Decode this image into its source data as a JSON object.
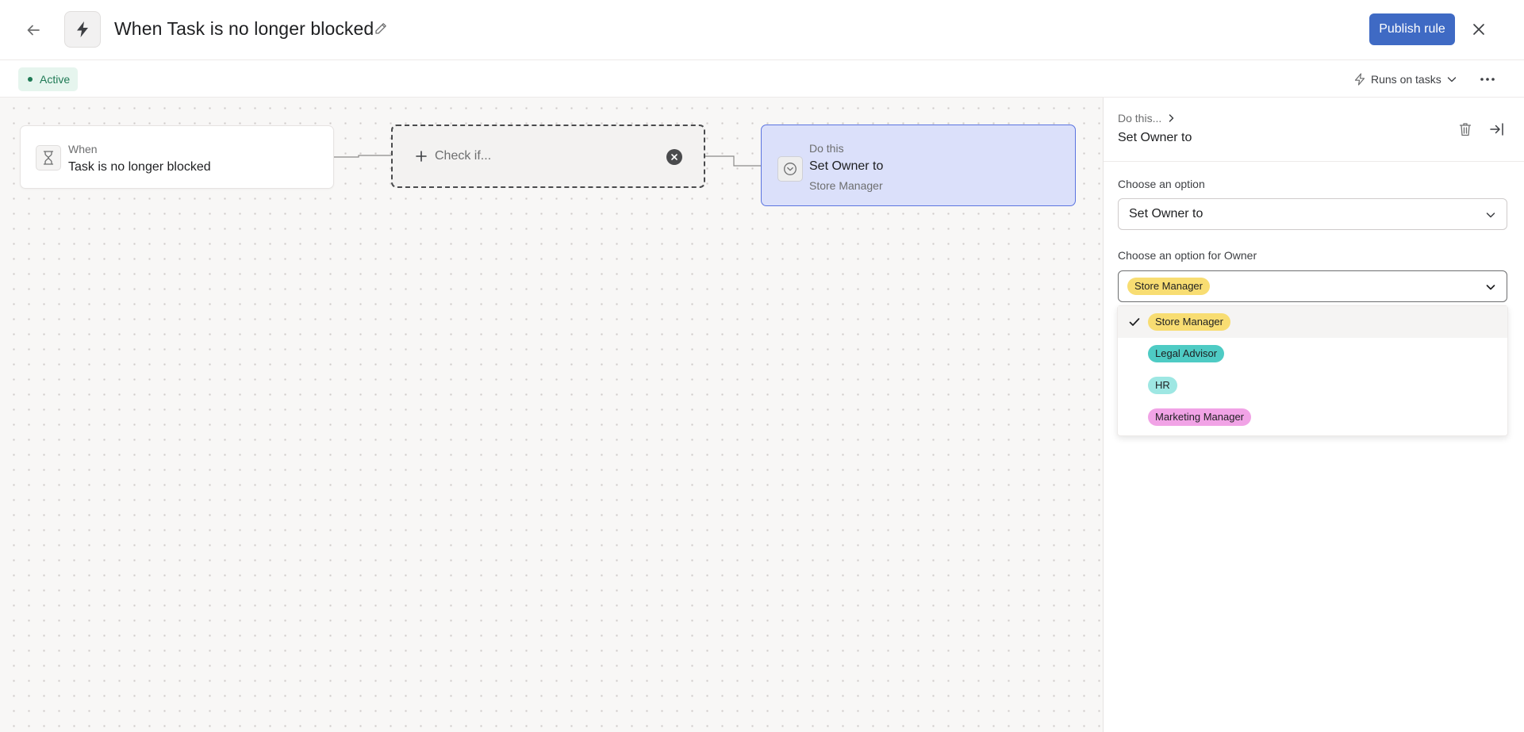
{
  "header": {
    "title": "When Task is no longer blocked",
    "publish_label": "Publish rule"
  },
  "subbar": {
    "status": "Active",
    "runs_on": "Runs on tasks"
  },
  "nodes": {
    "when": {
      "label": "When",
      "value": "Task is no longer blocked"
    },
    "check": {
      "label": "Check if..."
    },
    "do": {
      "label": "Do this",
      "value": "Set Owner to",
      "sub": "Store Manager"
    }
  },
  "panel": {
    "breadcrumb": "Do this...",
    "title": "Set Owner to",
    "field1_label": "Choose an option",
    "field1_value": "Set Owner to",
    "field2_label": "Choose an option for Owner",
    "field2_value": "Store Manager",
    "options": [
      {
        "label": "Store Manager",
        "color": "#f8dd72",
        "selected": true
      },
      {
        "label": "Legal Advisor",
        "color": "#4ecbc4",
        "selected": false
      },
      {
        "label": "HR",
        "color": "#9ee7e3",
        "selected": false
      },
      {
        "label": "Marketing Manager",
        "color": "#f1a3e6",
        "selected": false
      }
    ]
  },
  "colors": {
    "accent": "#3f6ac4",
    "status_bg": "#e6f5ee",
    "status_fg": "#1f7a55",
    "do_node_bg": "#dbe0fa",
    "do_node_border": "#5b74e0"
  },
  "icons": {
    "back": "arrow-left-icon",
    "bolt": "lightning-bolt-icon",
    "edit": "pencil-icon",
    "close": "close-icon",
    "runs_on": "lightning-outline-icon",
    "more": "more-horizontal-icon",
    "when_node": "hourglass-icon",
    "check_add": "plus-icon",
    "check_remove": "remove-circle-icon",
    "do_node": "chevron-circle-icon",
    "breadcrumb": "chevron-right-icon",
    "delete": "trash-icon",
    "collapse_panel": "collapse-right-icon",
    "dropdown": "chevron-down-icon",
    "selected": "check-icon"
  }
}
